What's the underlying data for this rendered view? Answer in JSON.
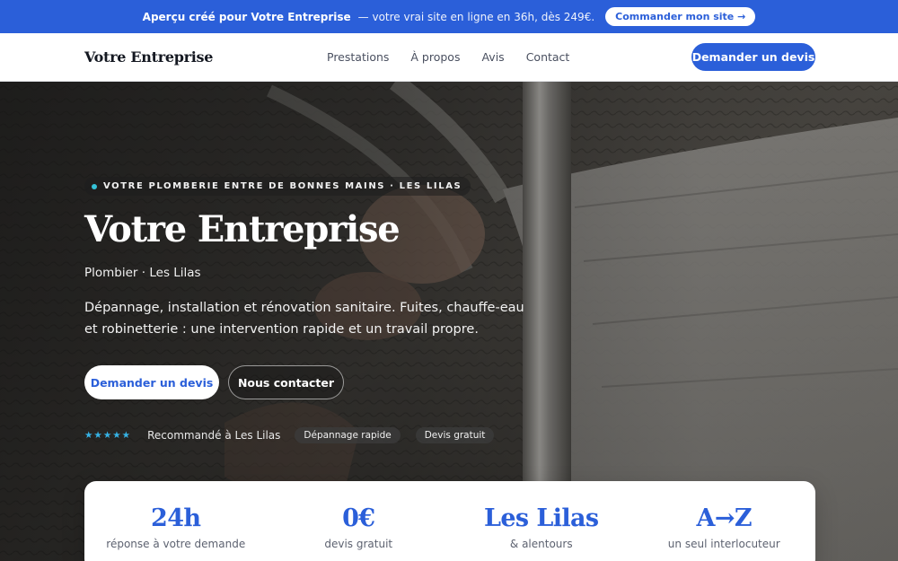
{
  "promo": {
    "lead": "Aperçu créé pour Votre Entreprise",
    "rest": "— votre vrai site en ligne en 36h, dès 249€.",
    "cta": "Commander mon site →"
  },
  "nav": {
    "brand": "Votre Entreprise",
    "links": [
      "Prestations",
      "À propos",
      "Avis",
      "Contact"
    ],
    "cta": "Demander un devis"
  },
  "hero": {
    "eyebrow": "VOTRE PLOMBERIE ENTRE DE BONNES MAINS · LES LILAS",
    "title": "Votre Entreprise",
    "subtitle": "Plombier · Les Lilas",
    "description": "Dépannage, installation et rénovation sanitaire. Fuites, chauffe-eau et robinetterie : une intervention rapide et un travail propre.",
    "primary_cta": "Demander un devis",
    "secondary_cta": "Nous contacter",
    "stars": "★★★★★",
    "trust_text": "Recommandé à Les Lilas",
    "chips": [
      "Dépannage rapide",
      "Devis gratuit"
    ]
  },
  "stats": [
    {
      "value": "24h",
      "label": "réponse à votre demande"
    },
    {
      "value": "0€",
      "label": "devis gratuit"
    },
    {
      "value": "Les Lilas",
      "label": "& alentours"
    },
    {
      "value": "A→Z",
      "label": "un seul interlocuteur"
    }
  ],
  "colors": {
    "accent": "#2b5fd9",
    "star": "#36b3e6",
    "promo_bar": "#2b5fd9"
  }
}
